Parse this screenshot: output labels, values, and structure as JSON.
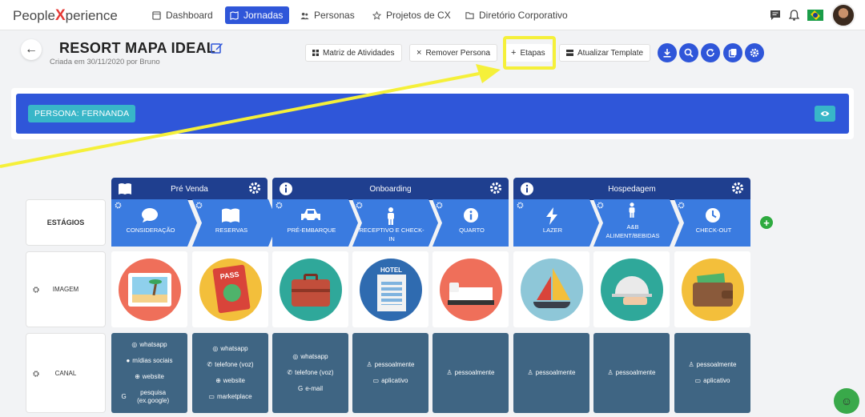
{
  "brand": {
    "people": "People",
    "x": "X",
    "perience": "perience"
  },
  "nav": [
    {
      "label": "Dashboard"
    },
    {
      "label": "Jornadas"
    },
    {
      "label": "Personas"
    },
    {
      "label": "Projetos de CX"
    },
    {
      "label": "Diretório Corporativo"
    }
  ],
  "header": {
    "title": "RESORT MAPA IDEAL",
    "created": "Criada em 30/11/2020 por Bruno"
  },
  "toolbar": {
    "matriz": "Matriz de Atividades",
    "remover": "Remover Persona",
    "etapas": "Etapas",
    "atualizar": "Atualizar Template"
  },
  "persona": {
    "label": "PERSONA: FERNANDA"
  },
  "rows": {
    "estagios": "ESTÁGIOS",
    "imagem": "IMAGEM",
    "canal": "CANAL"
  },
  "phases": [
    {
      "name": "Pré Venda"
    },
    {
      "name": "Onboarding"
    },
    {
      "name": "Hospedagem"
    }
  ],
  "stages": [
    {
      "label": "CONSIDERAÇÃO",
      "icon": "chat-icon"
    },
    {
      "label": "RESERVAS",
      "icon": "book-icon"
    },
    {
      "label": "PRÉ-EMBARQUE",
      "icon": "car-icon"
    },
    {
      "label": "RECEPTIVO E CHECK-IN",
      "icon": "person-icon"
    },
    {
      "label": "QUARTO",
      "icon": "info-icon"
    },
    {
      "label": "LAZER",
      "icon": "bolt-icon"
    },
    {
      "label": "A&B ALIMENT/BEBIDAS",
      "icon": "person-icon"
    },
    {
      "label": "CHECK-OUT",
      "icon": "clock-icon"
    }
  ],
  "images": [
    {
      "name": "beach-picture-image",
      "text": ""
    },
    {
      "name": "passport-image",
      "text": "PASS"
    },
    {
      "name": "suitcase-image",
      "text": ""
    },
    {
      "name": "hotel-building-image",
      "text": "HOTEL"
    },
    {
      "name": "bed-image",
      "text": ""
    },
    {
      "name": "sailboat-image",
      "text": ""
    },
    {
      "name": "food-cloche-image",
      "text": ""
    },
    {
      "name": "wallet-image",
      "text": ""
    }
  ],
  "canais": [
    [
      {
        "icon": "whatsapp-icon",
        "text": "whatsapp"
      },
      {
        "icon": "facebook-icon",
        "text": "mídias sociais"
      },
      {
        "icon": "globe-icon",
        "text": "website"
      },
      {
        "icon": "google-icon",
        "text": "pesquisa (ex.google)"
      }
    ],
    [
      {
        "icon": "whatsapp-icon",
        "text": "whatsapp"
      },
      {
        "icon": "phone-icon",
        "text": "telefone (voz)"
      },
      {
        "icon": "globe-icon",
        "text": "website"
      },
      {
        "icon": "monitor-icon",
        "text": "marketplace"
      }
    ],
    [
      {
        "icon": "whatsapp-icon",
        "text": "whatsapp"
      },
      {
        "icon": "phone-icon",
        "text": "telefone (voz)"
      },
      {
        "icon": "google-icon",
        "text": "e-mail"
      }
    ],
    [
      {
        "icon": "person-icon",
        "text": "pessoalmente"
      },
      {
        "icon": "monitor-icon",
        "text": "aplicativo"
      }
    ],
    [
      {
        "icon": "person-icon",
        "text": "pessoalmente"
      }
    ],
    [
      {
        "icon": "person-icon",
        "text": "pessoalmente"
      }
    ],
    [
      {
        "icon": "person-icon",
        "text": "pessoalmente"
      }
    ],
    [
      {
        "icon": "person-icon",
        "text": "pessoalmente"
      },
      {
        "icon": "monitor-icon",
        "text": "aplicativo"
      }
    ]
  ],
  "colors": {
    "primary": "#2f56d9",
    "stage": "#3a7be0",
    "phase": "#1f3f8f",
    "canal": "#3f6583",
    "teal": "#38b6c8",
    "highlight": "#f5f03a"
  }
}
